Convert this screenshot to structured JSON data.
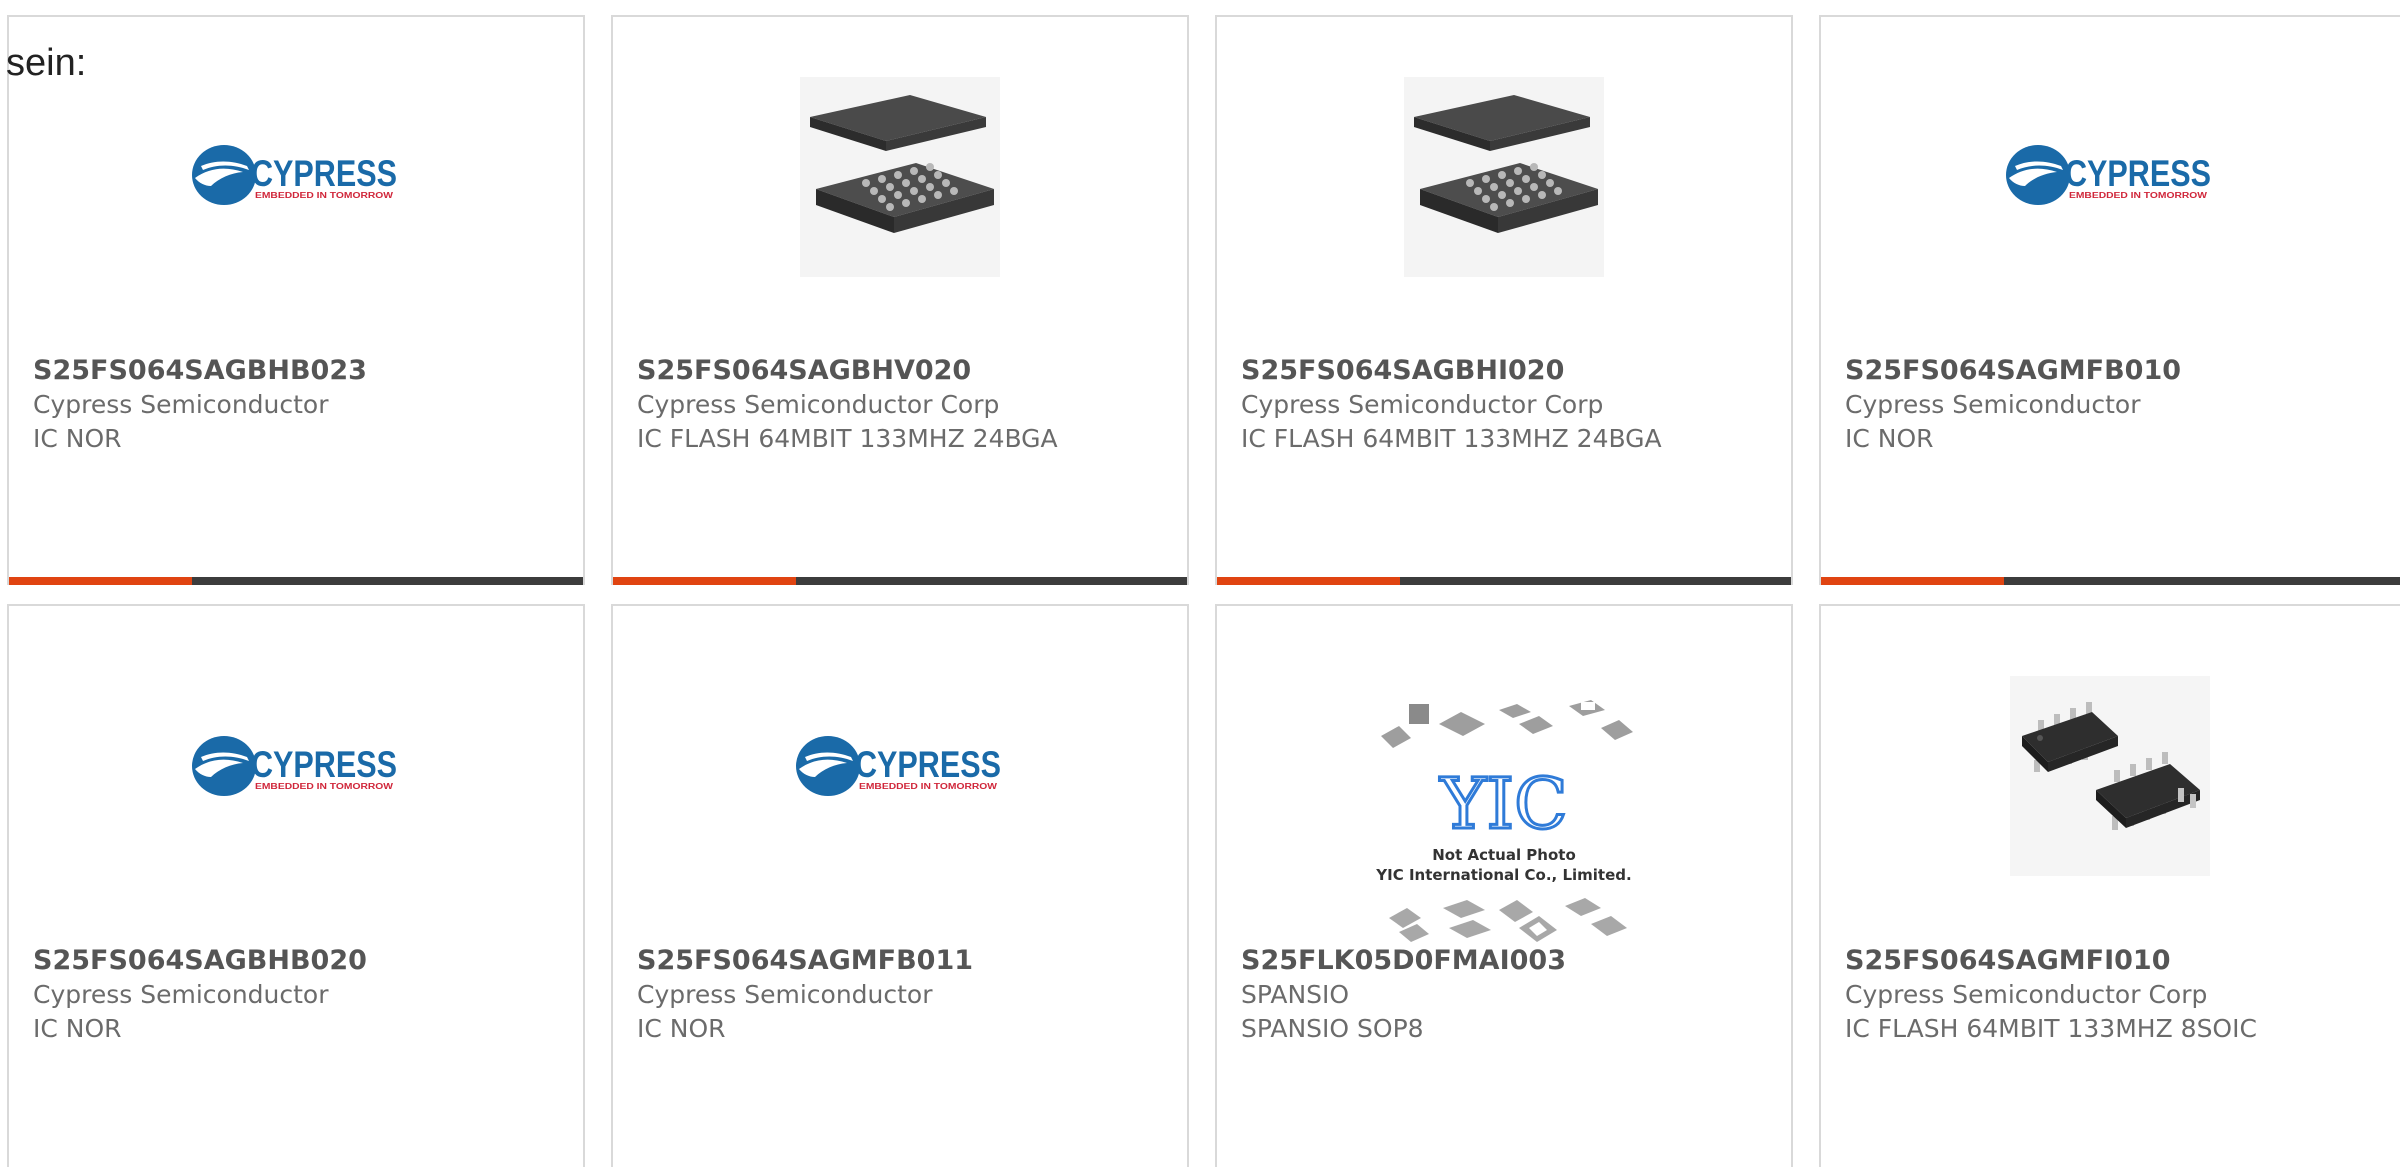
{
  "intro_text": "sein:",
  "colors": {
    "card_border": "#d9d9d9",
    "bar_dark": "#3c3c3c",
    "bar_accent": "#e04411",
    "cypress_blue": "#1a6aa8",
    "cypress_red": "#d0263a"
  },
  "logos": {
    "cypress_name": "CYPRESS",
    "cypress_tagline": "EMBEDDED IN TOMORROW",
    "yic_mark": "YIC",
    "yic_line1": "Not Actual Photo",
    "yic_line2": "YIC International Co., Limited."
  },
  "cards": [
    {
      "part": "S25FS064SAGBHB023",
      "manufacturer": "Cypress Semiconductor",
      "description": "IC NOR",
      "image": "cypress-logo"
    },
    {
      "part": "S25FS064SAGBHV020",
      "manufacturer": "Cypress Semiconductor Corp",
      "description": "IC FLASH 64MBIT 133MHZ 24BGA",
      "image": "bga-chip"
    },
    {
      "part": "S25FS064SAGBHI020",
      "manufacturer": "Cypress Semiconductor Corp",
      "description": "IC FLASH 64MBIT 133MHZ 24BGA",
      "image": "bga-chip"
    },
    {
      "part": "S25FS064SAGMFB010",
      "manufacturer": "Cypress Semiconductor",
      "description": "IC NOR",
      "image": "cypress-logo"
    },
    {
      "part": "S25FS064SAGBHB020",
      "manufacturer": "Cypress Semiconductor",
      "description": "IC NOR",
      "image": "cypress-logo"
    },
    {
      "part": "S25FS064SAGMFB011",
      "manufacturer": "Cypress Semiconductor",
      "description": "IC NOR",
      "image": "cypress-logo"
    },
    {
      "part": "S25FLK05D0FMAI003",
      "manufacturer": "SPANSIO",
      "description": "SPANSIO SOP8",
      "image": "yic-placeholder"
    },
    {
      "part": "S25FS064SAGMFI010",
      "manufacturer": "Cypress Semiconductor Corp",
      "description": "IC FLASH 64MBIT 133MHZ 8SOIC",
      "image": "soic-chip"
    }
  ]
}
